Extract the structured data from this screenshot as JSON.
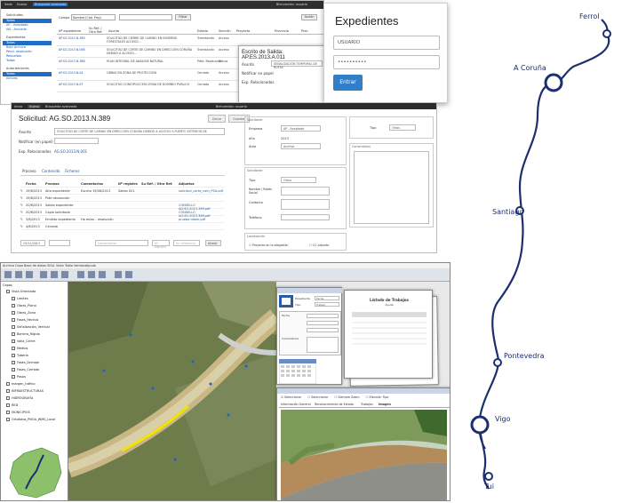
{
  "p1": {
    "topbar": [
      "Sede",
      "Nuevo",
      "Búsqueda avanzada"
    ],
    "topbar_right": "Bienvenido: usuario",
    "sidebar": {
      "sections": [
        {
          "title": "Solicitudes",
          "items": [
            "Todas",
            "AP - Aceptado",
            "AN - Anulado"
          ]
        },
        {
          "title": "Expedientes",
          "items": [
            "Todos",
            "Bajo Archivo",
            "Pend. resolución",
            "Resueltos",
            "Todos"
          ]
        },
        {
          "title": "Autorizaciones",
          "items": [
            "Todas",
            "Activas"
          ]
        }
      ]
    },
    "filter_label": "Campo",
    "filter_value": "Nombre (Cód. Proy)",
    "filter_btn": "Filtrar",
    "action_btn": "Acción",
    "header": [
      "Nº expediente",
      "Su Ref. / Otra Ref.",
      "Asunto",
      "Estado",
      "Sección",
      "Proyecto",
      "Provincia",
      "Proc."
    ],
    "rows": [
      {
        "id": "AP.SO.2013.N.389",
        "text": "SOLICITUD DE CIERRE DE CAMINO EN INVIERNO FORESTALES ACCESO...",
        "estado": "Tramitación",
        "seccion": "Acceso"
      },
      {
        "id": "AP.SO.2013.N.098",
        "text": "SOLICITUD DE CORTE DE CAMINO EN DIRECCIÓN CORUÑA DEBIDO A ACCESO...",
        "estado": "Tramitación",
        "seccion": "Acceso"
      },
      {
        "id": "AP.SO.2013.N.368",
        "text": "PLAN INTEGRAL DE ANÁLISIS NATURAL",
        "estado": "Pdte. Resolución",
        "seccion": "Aforos"
      },
      {
        "id": "AP.SO.2013.N.04",
        "text": "OBRAS EN ZONA DE PROTECCIÓN",
        "estado": "Cerrado",
        "seccion": "Acceso"
      },
      {
        "id": "AP.SO.2013.N.07",
        "text": "SOLICITUD CONSTRUCCIÓN ZONA DE DOMINIO PÚBLICO",
        "estado": "Cerrado",
        "seccion": "Acceso"
      }
    ]
  },
  "modal": {
    "title": "Escrito de Salida: AP.ES.2013.A.011",
    "asunto_label": "Asunto",
    "asunto_value": "SEÑALIZACIÓN TEMPORAL DE RUTAS",
    "notif_label": "Notificar en papel",
    "exp_label": "Exp. Relacionados",
    "tabs": [
      "Proceso",
      "Contenido",
      "Ficheros"
    ]
  },
  "login": {
    "title": "Expedientes",
    "user": "USUARIO",
    "pass": "••••••••••",
    "button": "Entrar"
  },
  "p2": {
    "toolbar": [
      "Inicio",
      "Nuevo",
      "Búsqueda avanzada"
    ],
    "toolbar_right": "Bienvenido: usuario",
    "title": "Solicitud: AG.SO.2013.N.389",
    "btn_cerrar": "Cerrar",
    "btn_guardar": "Guardar",
    "asunto_label": "Asunto",
    "asunto_value": "SOLICITUD DE CORTE DE CAMINO EN DIRECCIÓN CORUÑA DEBIDO A ACCESO A PUERTO EXTERIOR DE",
    "notif_label": "Notificar (en papel)",
    "exp_label": "Exp. Relacionados",
    "exp_value": "AG.SO.2013.N.001",
    "tabs": [
      "Proceso",
      "Contenido",
      "Ficheros"
    ],
    "table_header": [
      "Fecha",
      "Proceso",
      "Comentarios",
      "Nº registro",
      "Su Ref. / Otra Ref.",
      "Adjuntos"
    ],
    "rows": [
      [
        "19/6/2013",
        "Alta expediente",
        "Escrito 19/06/2013",
        "Salida 021",
        "",
        "solicitud_corte_cam_PSA.pdf"
      ],
      [
        "19/6/2013",
        "Pide devolución",
        "",
        "",
        "",
        ""
      ],
      [
        "20/6/2013",
        "Salida expediente",
        "",
        "",
        "",
        "CONSELLO AG.SO.2013.389.pdf"
      ],
      [
        "20/6/2013",
        "Copia solicitada",
        "",
        "",
        "",
        "CONSELLO AG.SO.2013.389.pdf"
      ],
      [
        "3/6/2013",
        "Emitido expediente",
        "Ha enlaz - resolución",
        "",
        "",
        "prueba idiom.pdf"
      ],
      [
        "4/6/2013",
        "Cerrado",
        "",
        "",
        "",
        ""
      ]
    ],
    "footer_date": "25/11/2013",
    "footer_placeholders": [
      "Comentarios",
      "Nº registro",
      "Su referencia"
    ],
    "footer_btn": "Añadir",
    "form": {
      "sec1": "Solicitante",
      "empresa_label": "Empresa",
      "empresa_value": "AP - Aceptada",
      "año_label": "Año",
      "año_value": "2013",
      "area_label": "Área",
      "area_value": "Archivo",
      "tipo_label": "Tipo",
      "tipo_value": "Otros",
      "sec2": "Solicitante",
      "tipo2_label": "Tipo",
      "tipo2_value": "Otros",
      "nombre_label": "Nombre / Razón Social",
      "contacto_label": "Contacto",
      "telefono_label": "Teléfono",
      "comentarios_label": "Comentarios",
      "sec3": "Localización",
      "chk1": "Proyecto en la alegación",
      "chk2": "CC adjunto"
    }
  },
  "p3": {
    "menu": [
      "Archivo",
      "Capa",
      "Base de datos",
      "SIGA",
      "Vista",
      "Tabla",
      "Ventana",
      "Ayuda"
    ],
    "layer_header": "Capas",
    "layers": [
      "Vista Orientada",
      "Límites",
      "Obras_Plano",
      "Obras_Zona",
      "Fases_Hechos",
      "Señalización_Vertical",
      "Barrera_Rígida",
      "Valla_Cierre",
      "Medios",
      "Tubería",
      "Fases_Drenaje",
      "Fases_Cerrado",
      "Pasos",
      "margen_tráfico",
      "INFRAESTRUCTURAS",
      "HIDROGRAFÍA",
      "RED",
      "MUNICIPIOS",
      "Ortofotos_PNOA_WMS_Local"
    ],
    "form_fields": [
      "Expediente",
      "Fecha",
      "Tipo",
      "Comentarios"
    ],
    "form_values": [
      "Fecha",
      "Trabajo"
    ],
    "report_title": "Listado de Trabajos",
    "report_sub": "Ayuda",
    "tabs": [
      "Información General",
      "Reconocimiento de Estado",
      "Trabajos",
      "Imagen"
    ],
    "checks": [
      "Seleccionar",
      "Seleccionar",
      "Siempre Zoom",
      "Elección Tipo"
    ]
  },
  "route": {
    "color": "#1c2f6f",
    "cities": [
      "Ferrol",
      "A Coruña",
      "Santiago",
      "Pontevedra",
      "Vigo",
      "Tui"
    ]
  }
}
